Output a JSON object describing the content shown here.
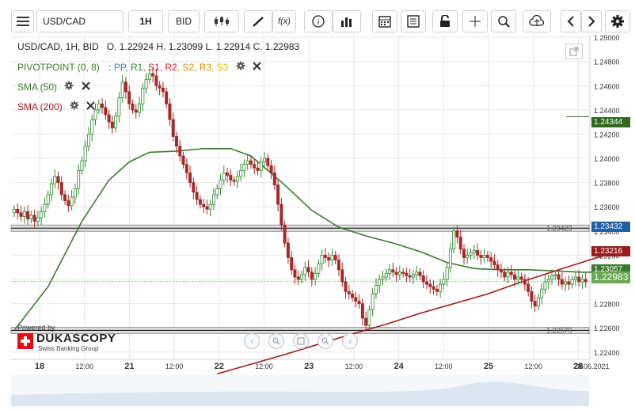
{
  "toolbar": {
    "symbol": "USD/CAD",
    "interval": "1H",
    "price_side": "BID",
    "fx_label": "f(x)",
    "icons": [
      "menu-icon",
      "candles-icon",
      "draw-pencil-icon",
      "fx-icon",
      "info-icon",
      "bar-chart-icon",
      "calendar-icon",
      "news-icon",
      "lock-icon",
      "crosshair-icon",
      "zoom-icon",
      "cloud-upload-icon",
      "arrow-left-icon",
      "arrow-right-icon",
      "gear-icon"
    ]
  },
  "legend": {
    "ohlc": "USD/CAD, 1H, BID   O. 1.22924 H. 1.23099 L. 1.22914 C. 1.22983",
    "pivot_name": "PIVOTPOINT (0, 8)",
    "pivot_colon": ":",
    "pivot_levels": [
      {
        "label": "PP",
        "color": "#3a7fd5"
      },
      {
        "label": "R1",
        "color": "#2e8b2e"
      },
      {
        "label": "S1",
        "color": "#d42020"
      },
      {
        "label": "R2",
        "color": "#d42020"
      },
      {
        "label": "S2",
        "color": "#e08a00"
      },
      {
        "label": "R3",
        "color": "#e08a00"
      },
      {
        "label": "S3",
        "color": "#e0c000"
      }
    ],
    "sma50": "SMA (50)",
    "sma200": "SMA (200)"
  },
  "colors": {
    "up": "#2e8b2e",
    "down": "#a52a2a",
    "sma50": "#3b7a2e",
    "sma200": "#9b1c1c",
    "grid": "#e8e8e8"
  },
  "price_tags": {
    "top_marker": "1.24344",
    "hline1": "1.23432",
    "sma200_value": "1.23216",
    "sma50_value": "1.23057",
    "current": "1.22983"
  },
  "hlines": {
    "upper_label": "1.23423",
    "lower_label": "1.22579"
  },
  "branding": {
    "powered_by": "Powered by",
    "name": "DUKASCOPY",
    "tagline": "Swiss Banking Group"
  },
  "nav_icons": [
    "zoom-out-icon",
    "zoom-out-small-icon",
    "fit-icon",
    "zoom-in-icon",
    "play-icon"
  ],
  "chart_data": {
    "type": "candlestick",
    "title": "USD/CAD, 1H, BID",
    "y_ticks": [
      "1.25000",
      "1.24800",
      "1.24600",
      "1.24400",
      "1.24200",
      "1.24000",
      "1.23800",
      "1.23600",
      "1.23400",
      "1.23200",
      "1.23000",
      "1.22800",
      "1.22600",
      "1.22400"
    ],
    "ylim": [
      1.2234,
      1.2502
    ],
    "x_ticks": [
      "18",
      "12:00",
      "21",
      "12:00",
      "22",
      "12:00",
      "23",
      "12:00",
      "24",
      "12:00",
      "25",
      "12:00",
      "28",
      "28.06.2021"
    ],
    "ohlc_last": {
      "open": 1.22924,
      "high": 1.23099,
      "low": 1.22914,
      "close": 1.22983
    },
    "sma50_points": [
      [
        0,
        1.2258
      ],
      [
        10,
        1.2294
      ],
      [
        20,
        1.2348
      ],
      [
        28,
        1.2382
      ],
      [
        34,
        1.2397
      ],
      [
        40,
        1.2405
      ],
      [
        48,
        1.2406
      ],
      [
        56,
        1.2408
      ],
      [
        64,
        1.2408
      ],
      [
        70,
        1.2402
      ],
      [
        80,
        1.2378
      ],
      [
        88,
        1.2357
      ],
      [
        96,
        1.2343
      ],
      [
        104,
        1.2336
      ],
      [
        112,
        1.233
      ],
      [
        120,
        1.2323
      ],
      [
        128,
        1.2314
      ],
      [
        136,
        1.2309
      ],
      [
        144,
        1.2308
      ],
      [
        152,
        1.2308
      ],
      [
        160,
        1.2307
      ],
      [
        168,
        1.2306
      ],
      [
        176,
        1.2306
      ]
    ],
    "sma200_points": [
      [
        60,
        1.2222
      ],
      [
        80,
        1.2238
      ],
      [
        100,
        1.2255
      ],
      [
        110,
        1.2263
      ],
      [
        120,
        1.2272
      ],
      [
        130,
        1.228
      ],
      [
        140,
        1.2288
      ],
      [
        150,
        1.2298
      ],
      [
        160,
        1.2307
      ],
      [
        170,
        1.2316
      ],
      [
        176,
        1.2321
      ]
    ],
    "candles_close": [
      1.2358,
      1.2355,
      1.2352,
      1.2356,
      1.235,
      1.2353,
      1.2348,
      1.2351,
      1.2356,
      1.2362,
      1.237,
      1.2379,
      1.2385,
      1.238,
      1.237,
      1.2365,
      1.2361,
      1.2368,
      1.2375,
      1.239,
      1.2398,
      1.241,
      1.242,
      1.2432,
      1.244,
      1.2445,
      1.2442,
      1.2436,
      1.243,
      1.2425,
      1.2435,
      1.245,
      1.2463,
      1.2455,
      1.2445,
      1.244,
      1.2438,
      1.2445,
      1.2458,
      1.2465,
      1.247,
      1.2468,
      1.246,
      1.2458,
      1.2455,
      1.2445,
      1.2432,
      1.2418,
      1.241,
      1.2402,
      1.2395,
      1.2388,
      1.238,
      1.2372,
      1.2366,
      1.2362,
      1.236,
      1.2358,
      1.2362,
      1.237,
      1.2375,
      1.2382,
      1.2388,
      1.2386,
      1.2382,
      1.2381,
      1.2385,
      1.239,
      1.2395,
      1.2398,
      1.2395,
      1.2392,
      1.239,
      1.2397,
      1.24,
      1.2394,
      1.2388,
      1.2378,
      1.2362,
      1.2345,
      1.233,
      1.2318,
      1.2308,
      1.2302,
      1.23,
      1.2304,
      1.231,
      1.2306,
      1.23,
      1.2305,
      1.2313,
      1.232,
      1.2318,
      1.2316,
      1.232,
      1.2316,
      1.2308,
      1.2298,
      1.229,
      1.2288,
      1.2285,
      1.2282,
      1.228,
      1.2268,
      1.2262,
      1.2275,
      1.2288,
      1.2295,
      1.23,
      1.2302,
      1.2305,
      1.2308,
      1.2306,
      1.2304,
      1.2306,
      1.2305,
      1.2303,
      1.2302,
      1.2304,
      1.2306,
      1.2303,
      1.2298,
      1.2296,
      1.2294,
      1.2292,
      1.229,
      1.2296,
      1.23,
      1.231,
      1.2325,
      1.234,
      1.2335,
      1.2325,
      1.2318,
      1.232,
      1.2322,
      1.2324,
      1.232,
      1.2318,
      1.232,
      1.2318,
      1.2315,
      1.2312,
      1.2308,
      1.2306,
      1.2302,
      1.2306,
      1.2304,
      1.23,
      1.2302,
      1.23,
      1.2296,
      1.229,
      1.2282,
      1.2278,
      1.2285,
      1.2292,
      1.2298,
      1.23,
      1.2303,
      1.2304,
      1.23,
      1.2296,
      1.2298,
      1.2296,
      1.23,
      1.2302,
      1.2298,
      1.23,
      1.2298
    ]
  }
}
